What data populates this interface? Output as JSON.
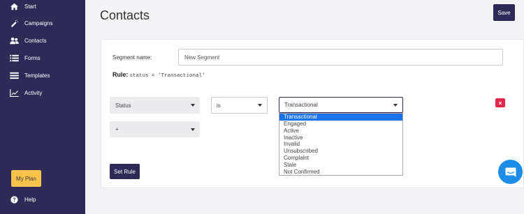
{
  "sidebar": {
    "items": [
      {
        "label": "Start",
        "icon": "home-icon"
      },
      {
        "label": "Campaigns",
        "icon": "magic-wand-icon"
      },
      {
        "label": "Contacts",
        "icon": "users-icon"
      },
      {
        "label": "Forms",
        "icon": "list-icon"
      },
      {
        "label": "Templates",
        "icon": "bars-icon"
      },
      {
        "label": "Activity",
        "icon": "chart-line-icon"
      }
    ],
    "plan_label": "My Plan",
    "help_label": "Help"
  },
  "header": {
    "title": "Contacts",
    "save_label": "Save"
  },
  "segment": {
    "name_label": "Segment name:",
    "name_value": "New Segment",
    "rule_label": "Rule:",
    "rule_expr": "status = 'Transactional'"
  },
  "rule_row": {
    "field": "Status",
    "operator": "is",
    "value": "Transactional",
    "add_field": "+"
  },
  "value_options": [
    "Transactional",
    "Engaged",
    "Active",
    "Inactive",
    "Invalid",
    "Unsubscribed",
    "Complaint",
    "Stale",
    "Not Confirmed"
  ],
  "selected_option": "Transactional",
  "actions": {
    "set_rule_label": "Set Rule",
    "delete_symbol": "×"
  },
  "colors": {
    "sidebar_bg": "#2d2a57",
    "accent_button": "#2d2a57",
    "plan_button": "#f7c34a",
    "delete_button": "#e0294a",
    "option_highlight": "#1a73e8",
    "chat_button": "#1d8ee8"
  }
}
